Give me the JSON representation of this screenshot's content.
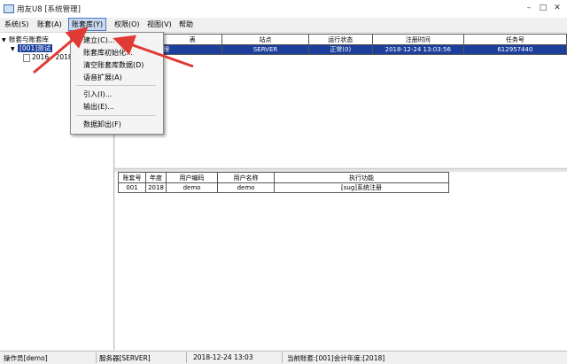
{
  "window": {
    "title": "用友U8 [系统管理]",
    "min": "–",
    "max": "□",
    "close": "✕"
  },
  "menubar": [
    {
      "label": "系统(S)"
    },
    {
      "label": "账套(A)"
    },
    {
      "label": "账套库(Y)"
    },
    {
      "label": "权限(O)"
    },
    {
      "label": "视图(V)"
    },
    {
      "label": "帮助"
    }
  ],
  "tree": {
    "root": "账套与账套库",
    "child": "[001]测试",
    "leaf": "2016 - 2018"
  },
  "dropdown": {
    "items": [
      {
        "label": "建立(C)..."
      },
      {
        "label": "账套库初始化..."
      },
      {
        "label": "清空账套库数据(D)"
      },
      {
        "label": "语音扩展(A)"
      },
      {
        "label": "引入(I)..."
      },
      {
        "label": "输出(E)..."
      },
      {
        "label": "数据卸出(F)"
      }
    ]
  },
  "top_table": {
    "headers": [
      "表",
      "站点",
      "运行状态",
      "注册时间",
      "任务号"
    ],
    "rows": [
      [
        "理",
        "SERVER",
        "正常(0)",
        "2018-12-24 13:03:56",
        "612957440"
      ]
    ]
  },
  "bottom_table": {
    "headers": [
      "账套号",
      "年度",
      "用户编码",
      "用户名称",
      "执行功能"
    ],
    "rows": [
      [
        "001",
        "2018",
        "demo",
        "demo",
        "[sug]系统注册"
      ]
    ]
  },
  "statusbar": {
    "operator": "操作员[demo]",
    "server": "服务器[SERVER]",
    "time": "2018-12-24 13:03",
    "current": "当前账套:[001]会计年度:[2018]"
  },
  "colors": {
    "selection": "#1c3f9c",
    "arrow": "#e03a35",
    "menu_highlight": "#c9daf1"
  }
}
